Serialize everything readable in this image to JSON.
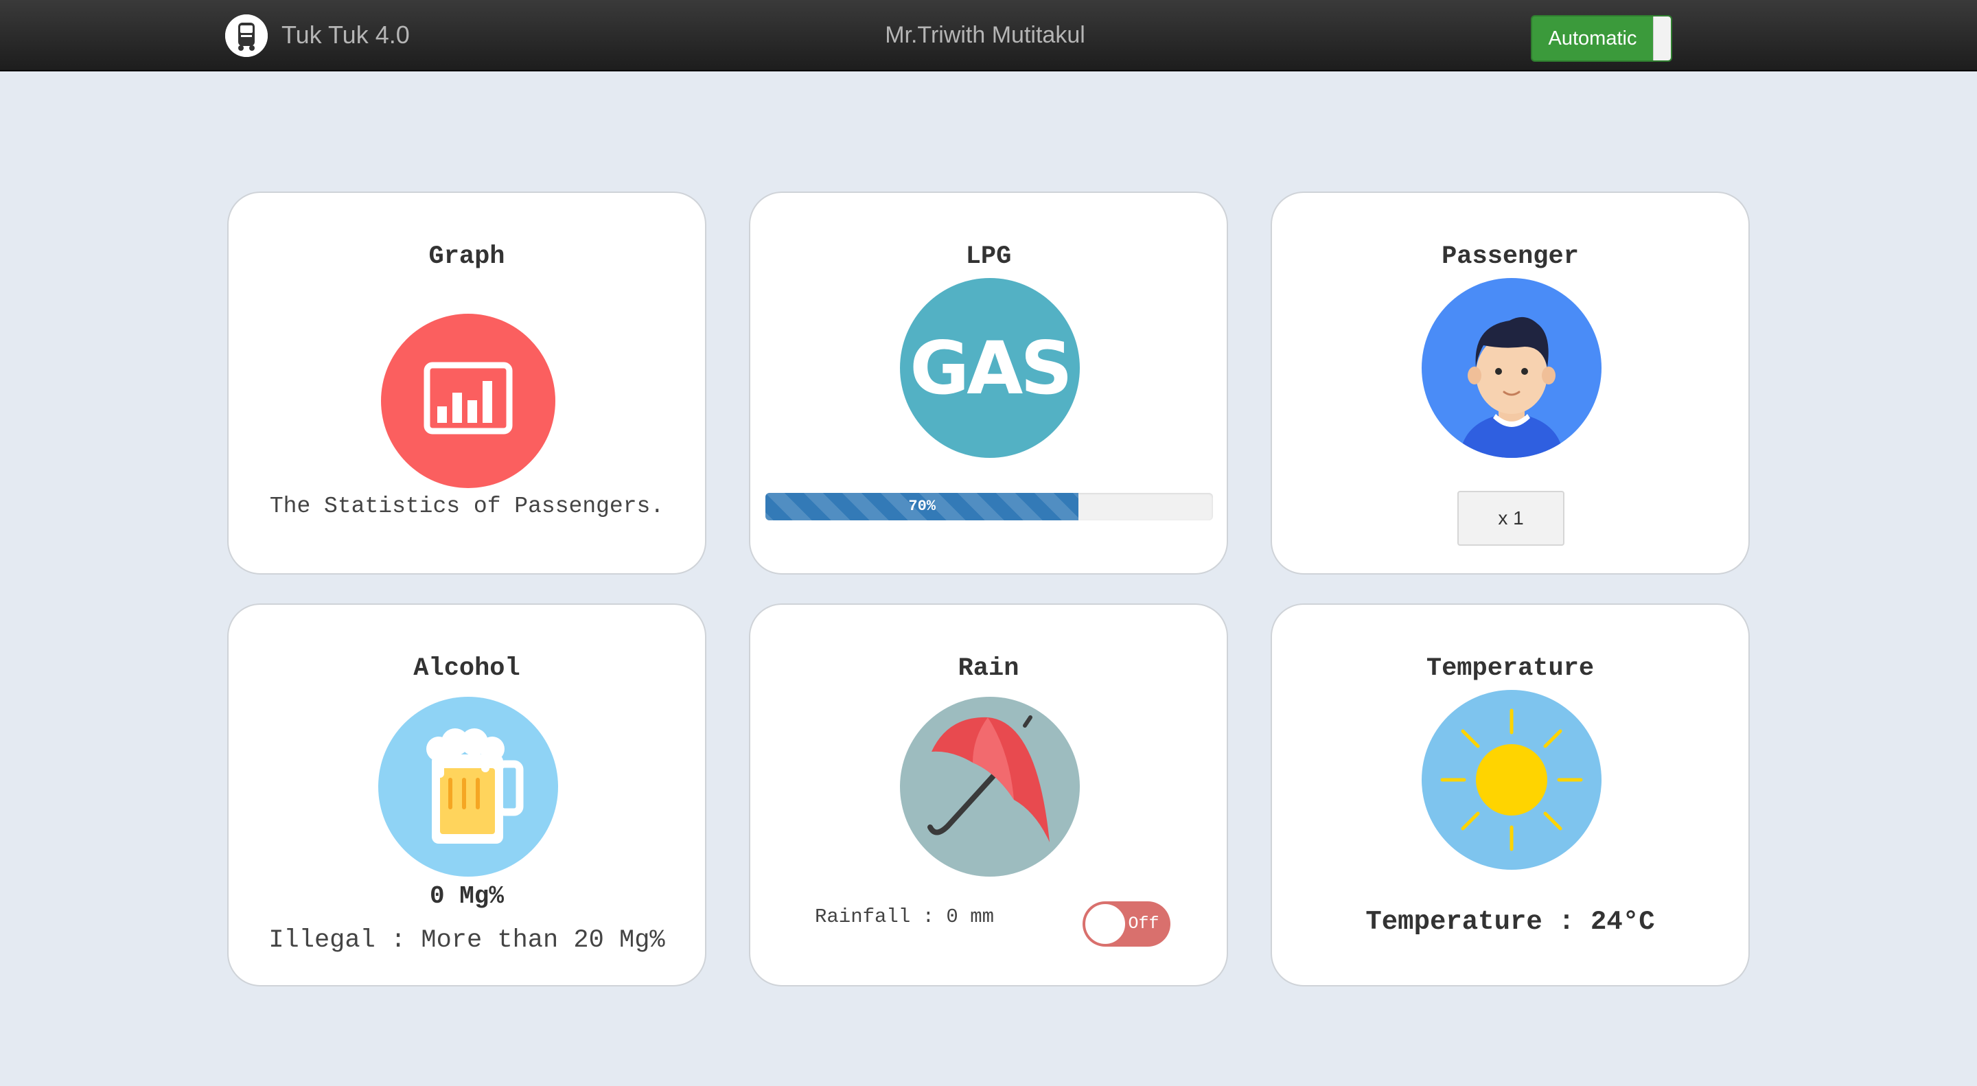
{
  "navbar": {
    "brand_title": "Tuk Tuk 4.0",
    "owner_name": "Mr.Triwith Mutitakul",
    "mode_label": "Automatic",
    "brand_icon": "tuk-tuk-icon"
  },
  "cards": {
    "graph": {
      "title": "Graph",
      "icon": "bar-chart-icon",
      "description": "The Statistics of Passengers.",
      "color": "#fb5f5f"
    },
    "lpg": {
      "title": "LPG",
      "icon_text": "GAS",
      "progress_percent": 70,
      "progress_label": "70%",
      "color": "#53b1c4"
    },
    "passenger": {
      "title": "Passenger",
      "icon": "person-avatar-icon",
      "count_label": "x 1",
      "color": "#3b88f5"
    },
    "alcohol": {
      "title": "Alcohol",
      "icon": "beer-mug-icon",
      "value_label": "0 Mg%",
      "note": "Illegal : More than 20 Mg%",
      "color": "#8fd3f5"
    },
    "rain": {
      "title": "Rain",
      "icon": "umbrella-icon",
      "rainfall_label": "Rainfall : 0 mm",
      "switch_label": "Off",
      "color": "#9dbcbf"
    },
    "temperature": {
      "title": "Temperature",
      "icon": "sun-icon",
      "value_label": "Temperature : 24°C",
      "color": "#7ec4ee"
    }
  }
}
